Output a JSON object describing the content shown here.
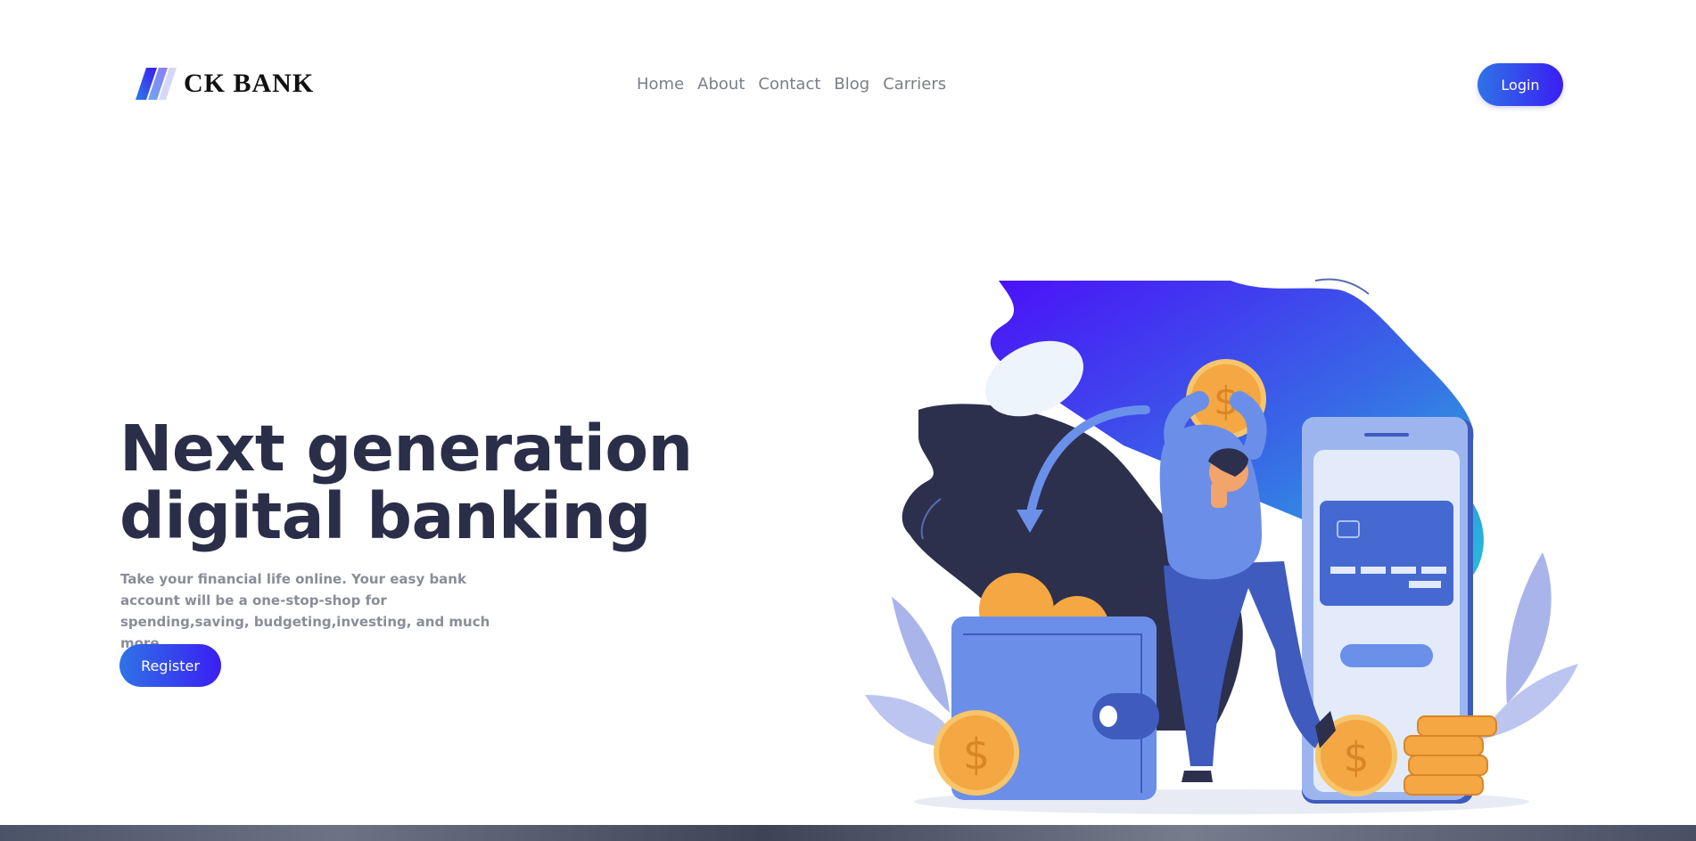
{
  "header": {
    "logo_text": "CK BANK",
    "nav_items": [
      {
        "label": "Home"
      },
      {
        "label": "About"
      },
      {
        "label": "Contact"
      },
      {
        "label": "Blog"
      },
      {
        "label": "Carriers"
      }
    ],
    "login_label": "Login"
  },
  "hero": {
    "title_line1": "Next generation",
    "title_line2": "digital banking",
    "description": "Take your financial life online. Your easy bank account will be a one-stop-shop for spending,saving, budgeting,investing, and much more.",
    "register_label": "Register"
  },
  "colors": {
    "accent_gradient_start": "#2f73e6",
    "accent_gradient_end": "#3a1ef3",
    "title_color": "#2b2e48",
    "coin": "#f4a742"
  }
}
